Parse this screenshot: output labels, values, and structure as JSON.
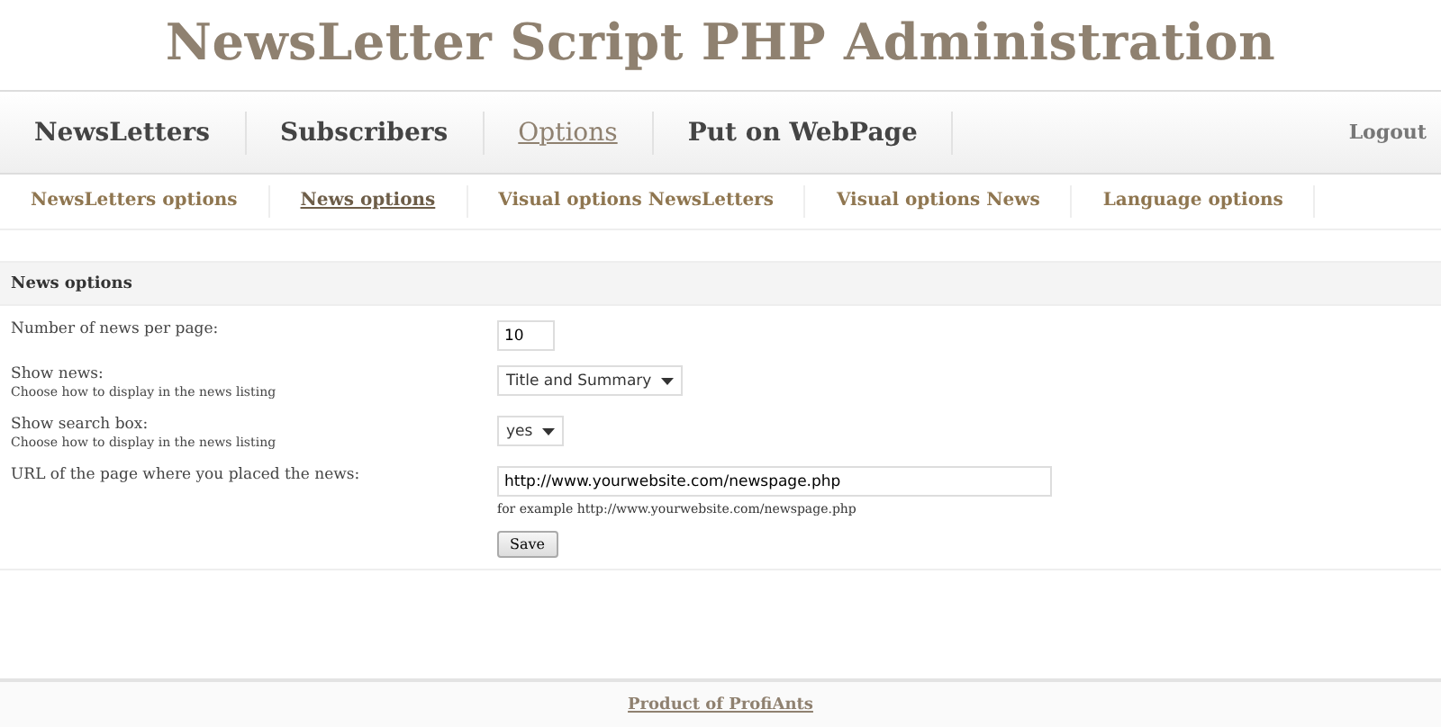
{
  "title": "NewsLetter Script PHP Administration",
  "nav": [
    {
      "label": "NewsLetters",
      "selected": false
    },
    {
      "label": "Subscribers",
      "selected": false
    },
    {
      "label": "Options",
      "selected": true
    },
    {
      "label": "Put on WebPage",
      "selected": false
    }
  ],
  "logout": "Logout",
  "subnav": [
    {
      "label": "NewsLetters options",
      "selected": false
    },
    {
      "label": "News options",
      "selected": true
    },
    {
      "label": "Visual options NewsLetters",
      "selected": false
    },
    {
      "label": "Visual options News",
      "selected": false
    },
    {
      "label": "Language options",
      "selected": false
    }
  ],
  "section": {
    "title": "News options",
    "rows": [
      {
        "kind": "text",
        "label": "Number of news per page:",
        "value": "10"
      },
      {
        "kind": "select",
        "label": "Show news:",
        "hint": "Choose how to display in the news listing",
        "value": "Title and Summary"
      },
      {
        "kind": "select",
        "label": "Show search box:",
        "hint": "Choose how to display in the news listing",
        "value": "yes"
      },
      {
        "kind": "url",
        "label": "URL of the page where you placed the news:",
        "value": "http://www.yourwebsite.com/newspage.php",
        "note": "for example http://www.yourwebsite.com/newspage.php"
      }
    ],
    "save": "Save"
  },
  "footer": "Product of ProfiAnts"
}
